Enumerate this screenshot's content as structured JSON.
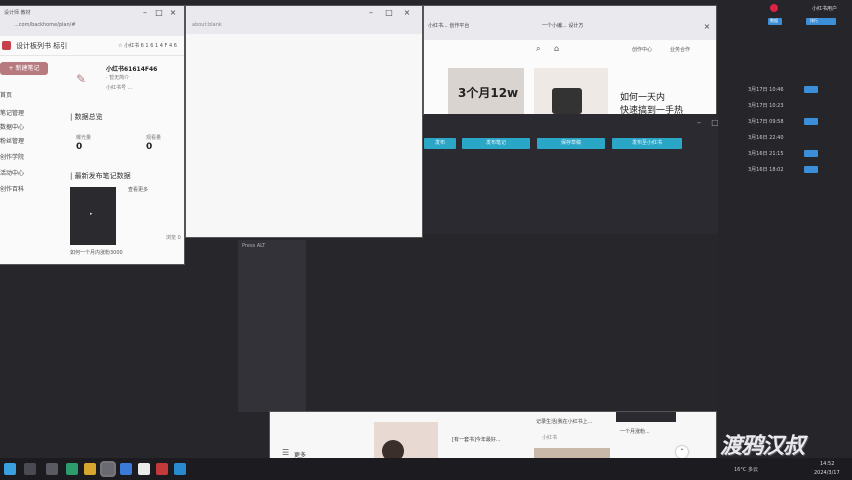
{
  "left_window": {
    "url": "...com/backhome/plan/#",
    "tab_title": "设计师 教材",
    "logo": "设计板列书 标引",
    "top_right_text": "☆ 小红书 6 1 6 1 4 F 4 6",
    "primary_button": "+ 新建笔记",
    "account_name": "小红书61614F46",
    "account_sub": "· 暂无简介",
    "account_id": "小红书号 ...",
    "section_data": "| 数据总览",
    "stat1_label": "曝光量",
    "stat1_value": "0",
    "stat2_label": "观看量",
    "stat2_value": "0",
    "section_latest": "| 最新发布笔记数据",
    "latest_link": "查看更多",
    "note_caption": "如何一个月内涨粉3000",
    "note_meta": "浏览 0",
    "sidebar": [
      "首页",
      "笔记管理",
      "数据中心",
      "粉丝管理",
      "创作学院",
      "活动中心",
      "创作百科"
    ]
  },
  "middle_window": {
    "url": "about:blank"
  },
  "browser_window": {
    "tabs": [
      "小红书... 创作平台",
      "一个小编... 设计方"
    ],
    "thumb_text": "3个月12w",
    "headline_line1": "如何一天内",
    "headline_line2": "快速搞到一手热",
    "nav_left": "创作中心",
    "nav_right": "业务合作"
  },
  "dark_window": {
    "buttons": [
      "发布",
      "发布笔记",
      "保存草稿",
      "发布至小红书"
    ]
  },
  "scroll_panel": {
    "label": "Press ALT"
  },
  "bottom_window": {
    "more_label": "更多",
    "card1_text": "[有一套书]今年最好...",
    "card2_text": "记录生活|我在小红书上...",
    "card3_text": "一个月涨粉...",
    "card_meta": "小红书"
  },
  "right_panel": {
    "user": "小红书用户",
    "chips": [
      "数据",
      "排行"
    ],
    "rows": [
      "3月17日 10:46",
      "3月17日 10:23",
      "3月17日 09:58",
      "3月16日 22:40",
      "3月16日 21:15",
      "3月16日 18:02"
    ],
    "watermark": "渡鸦汉叔"
  },
  "taskbar": {
    "temperature": "16°C 多云",
    "time": "14:52",
    "date": "2024/3/17"
  },
  "colors": {
    "accent_teal": "#2aa6c7",
    "brand_red": "#c7404a",
    "desktop": "#27262b"
  }
}
